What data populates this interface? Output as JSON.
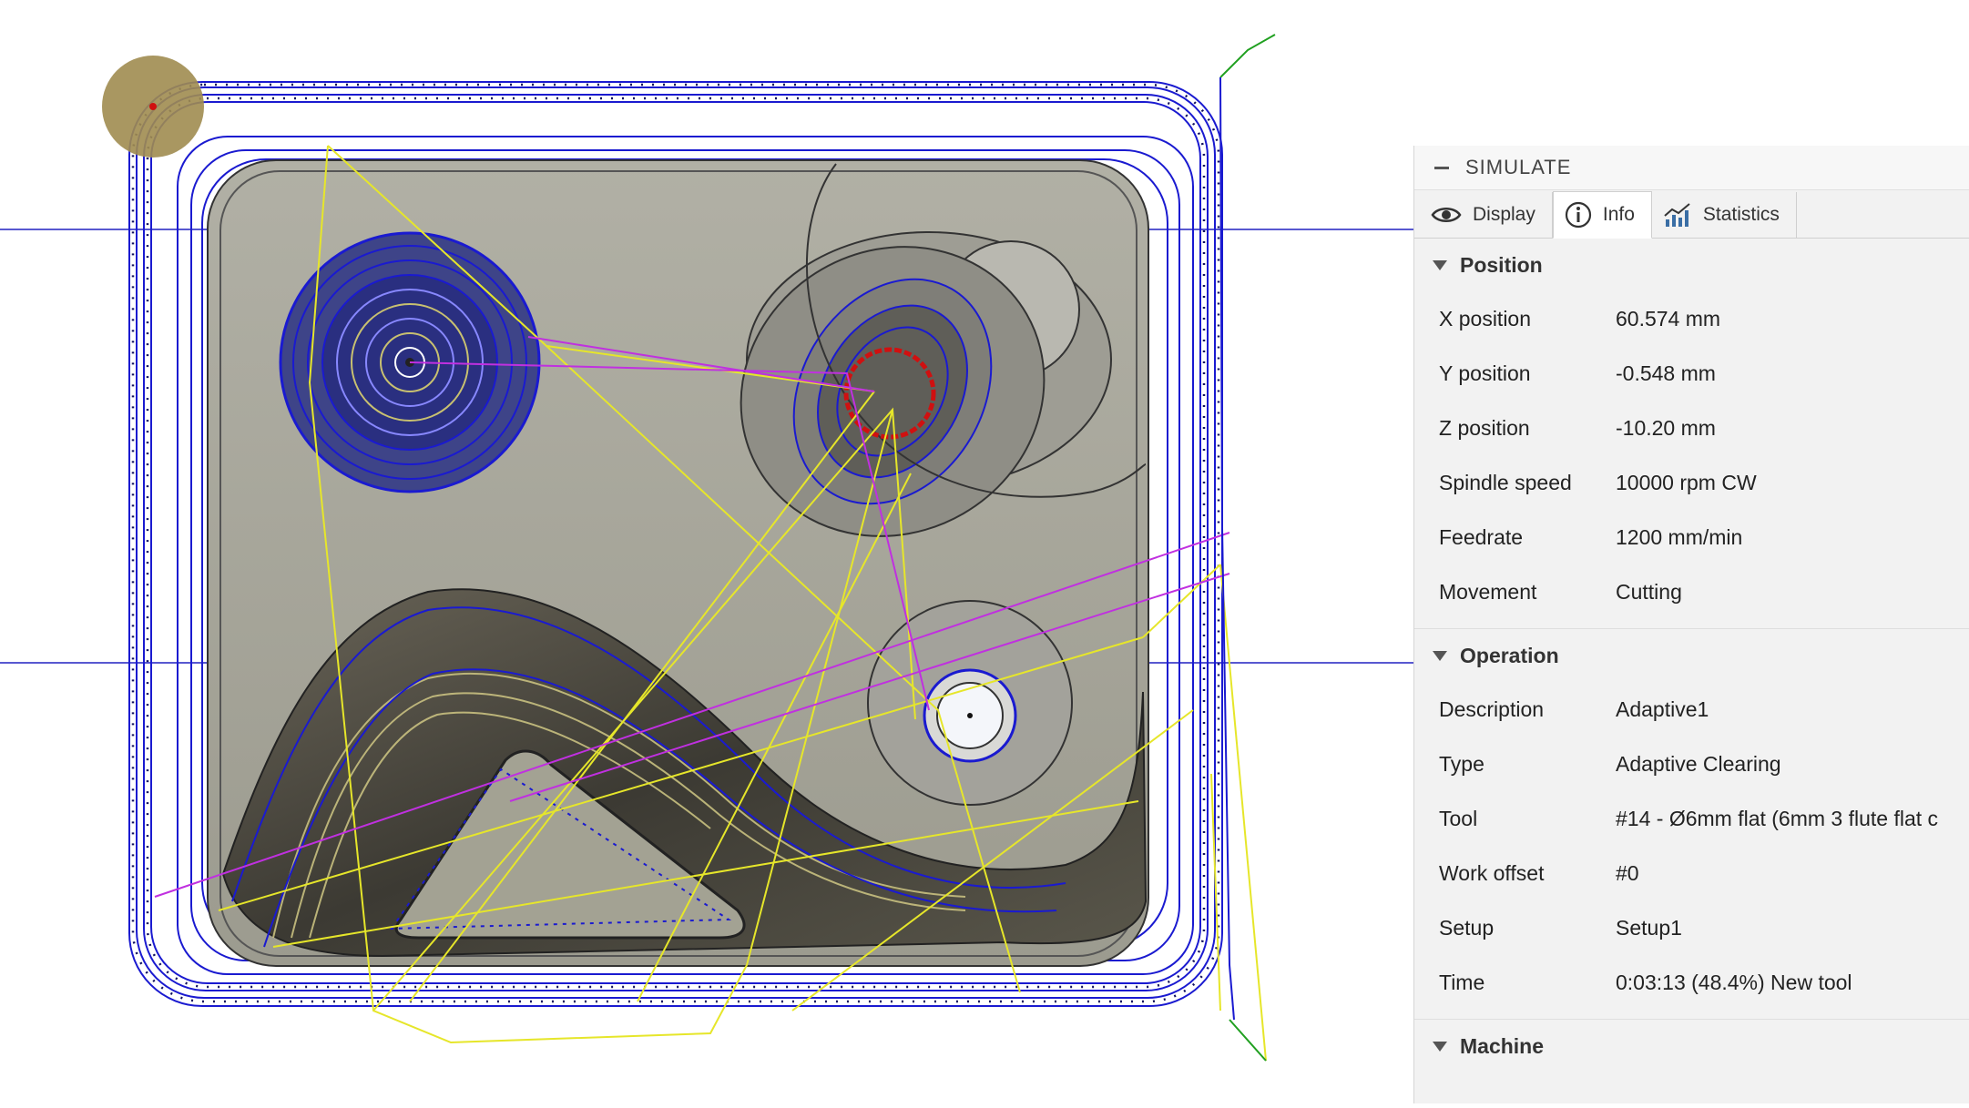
{
  "panel": {
    "title": "SIMULATE",
    "tabs": [
      {
        "label": "Display",
        "icon": "eye-icon",
        "active": false
      },
      {
        "label": "Info",
        "icon": "info-icon",
        "active": true
      },
      {
        "label": "Statistics",
        "icon": "statistics-icon",
        "active": false
      }
    ],
    "position": {
      "header": "Position",
      "rows": [
        {
          "label": "X position",
          "value": "60.574 mm"
        },
        {
          "label": "Y position",
          "value": "-0.548 mm"
        },
        {
          "label": "Z position",
          "value": "-10.20 mm"
        },
        {
          "label": "Spindle speed",
          "value": "10000 rpm CW"
        },
        {
          "label": "Feedrate",
          "value": "1200 mm/min"
        },
        {
          "label": "Movement",
          "value": "Cutting"
        }
      ]
    },
    "operation": {
      "header": "Operation",
      "rows": [
        {
          "label": "Description",
          "value": "Adaptive1"
        },
        {
          "label": "Type",
          "value": "Adaptive Clearing"
        },
        {
          "label": "Tool",
          "value": "#14 - Ø6mm flat (6mm 3 flute flat c"
        },
        {
          "label": "Work offset",
          "value": "#0"
        },
        {
          "label": "Setup",
          "value": "Setup1"
        },
        {
          "label": "Time",
          "value": "0:03:13 (48.4%) New tool"
        }
      ]
    },
    "machine": {
      "header": "Machine"
    }
  },
  "colors": {
    "toolpath_blue": "#1a1ad0",
    "rapid_yellow": "#e8e82a",
    "link_magenta": "#c030e0",
    "lead_green": "#20a020",
    "part_gray": "#a9a89a",
    "tool_gold": "#a08c50",
    "annotation_red": "#e02020"
  }
}
